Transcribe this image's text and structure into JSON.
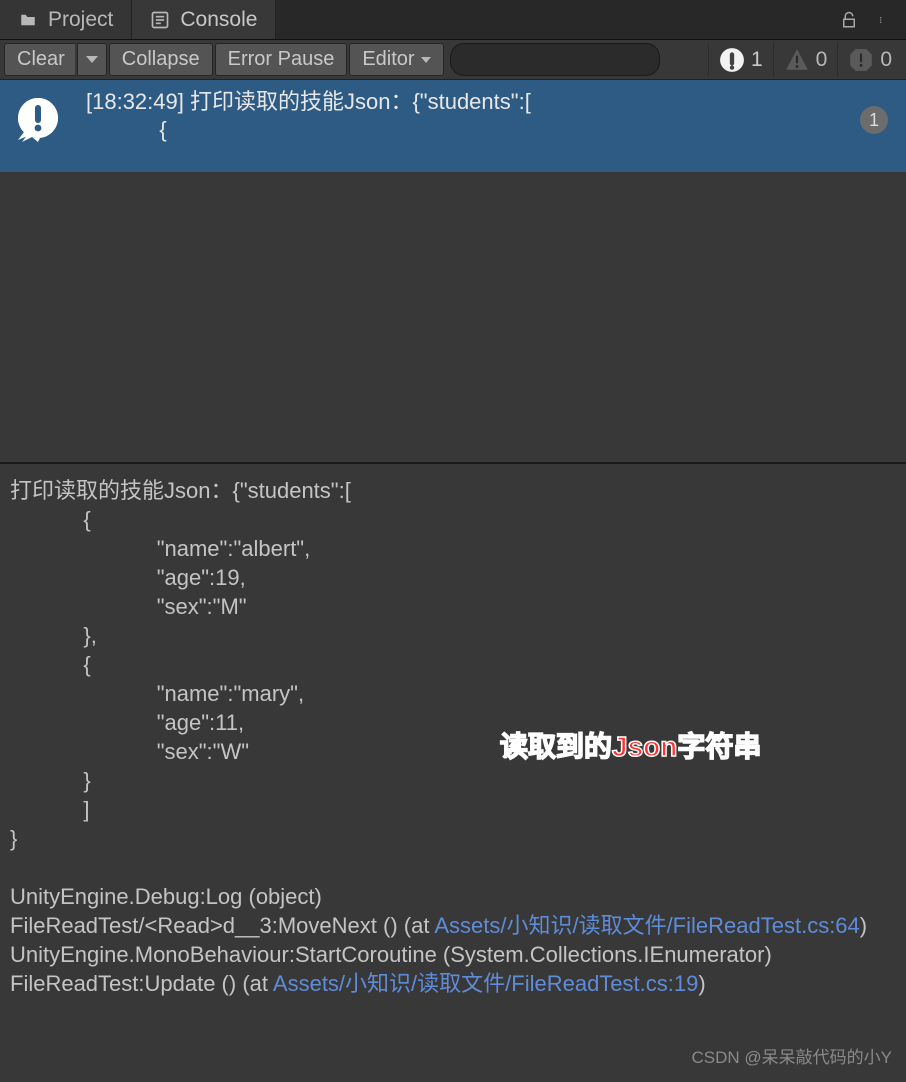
{
  "tabs": {
    "project": "Project",
    "console": "Console"
  },
  "toolbar": {
    "clear": "Clear",
    "collapse": "Collapse",
    "error_pause": "Error Pause",
    "editor": "Editor"
  },
  "counters": {
    "info": "1",
    "warn": "0",
    "error": "0"
  },
  "log": {
    "line1": "[18:32:49] 打印读取的技能Json：{\"students\":[",
    "line2": "            {",
    "badge": "1"
  },
  "detail": {
    "pre_lines": "打印读取的技能Json：{\"students\":[\n            {\n                        \"name\":\"albert\",\n                        \"age\":19,\n                        \"sex\":\"M\"\n            },\n            {\n                        \"name\":\"mary\",\n                        \"age\":11,\n                        \"sex\":\"W\"\n            }\n            ]\n}\n",
    "stack1": "UnityEngine.Debug:Log (object)",
    "stack2a": "FileReadTest/<Read>d__3:MoveNext () (at ",
    "stack2_link": "Assets/小知识/读取文件/FileReadTest.cs:64",
    "stack2b": ")",
    "stack3": "UnityEngine.MonoBehaviour:StartCoroutine (System.Collections.IEnumerator)",
    "stack4a": "FileReadTest:Update () (at ",
    "stack4_link": "Assets/小知识/读取文件/FileReadTest.cs:19",
    "stack4b": ")"
  },
  "annotation": "读取到的Json字符串",
  "watermark": "CSDN @呆呆敲代码的小Y",
  "search": {
    "placeholder": ""
  }
}
